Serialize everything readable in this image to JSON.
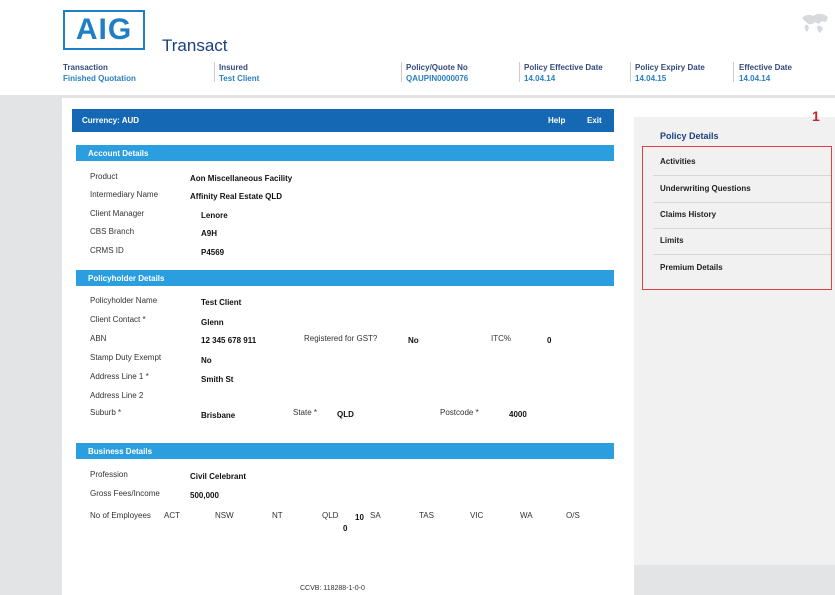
{
  "header": {
    "logo_text": "AIG",
    "app_title": "Transact",
    "columns": [
      {
        "label": "Transaction",
        "value": "Finished Quotation"
      },
      {
        "label": "Insured",
        "value": "Test Client"
      },
      {
        "label": "Policy/Quote No",
        "value": "QAUPIN0000076"
      },
      {
        "label": "Policy Effective Date",
        "value": "14.04.14"
      },
      {
        "label": "Policy Expiry Date",
        "value": "14.04.15"
      },
      {
        "label": "Effective Date",
        "value": "14.04.14"
      }
    ]
  },
  "toolbar": {
    "currency": "Currency: AUD",
    "help": "Help",
    "exit": "Exit"
  },
  "account": {
    "title": "Account Details",
    "product_label": "Product",
    "product": "Aon Miscellaneous Facility",
    "intermediary_label": "Intermediary Name",
    "intermediary": "Affinity Real Estate QLD",
    "client_manager_label": "Client Manager",
    "client_manager": "Lenore",
    "cbs_branch_label": "CBS Branch",
    "cbs_branch": "A9H",
    "crms_label": "CRMS ID",
    "crms": "P4569"
  },
  "policyholder": {
    "title": "Policyholder Details",
    "name_label": "Policyholder Name",
    "name": "Test Client",
    "contact_label": "Client Contact *",
    "contact": "Glenn",
    "abn_label": "ABN",
    "abn": "12 345 678 911",
    "gst_label": "Registered for GST?",
    "gst": "No",
    "itc_label": "ITC%",
    "itc": "0",
    "stamp_label": "Stamp Duty Exempt",
    "stamp": "No",
    "addr1_label": "Address Line 1 *",
    "addr1": "Smith St",
    "addr2_label": "Address Line 2",
    "suburb_label": "Suburb *",
    "suburb": "Brisbane",
    "state_label": "State *",
    "state": "QLD",
    "postcode_label": "Postcode *",
    "postcode": "4000"
  },
  "business": {
    "title": "Business Details",
    "profession_label": "Profession",
    "profession": "Civil Celebrant",
    "fees_label": "Gross Fees/Income",
    "fees": "500,000",
    "employees_label": "No of Employees",
    "act": "ACT",
    "nsw": "NSW",
    "nt": "NT",
    "qld": "QLD",
    "qld_value": "10",
    "qld_value2": "0",
    "sa": "SA",
    "tas": "TAS",
    "vic": "VIC",
    "wa": "WA",
    "os": "O/S"
  },
  "nav": {
    "title": "Policy Details",
    "items": [
      "Activities",
      "Underwriting Questions",
      "Claims History",
      "Limits",
      "Premium Details"
    ],
    "marker": "1"
  },
  "footer": {
    "text": "CCVB: 118288-1-0-0"
  },
  "colors": {
    "brand_blue": "#1568b3",
    "section_blue": "#2b9ee0",
    "highlight_red": "#e04040"
  }
}
